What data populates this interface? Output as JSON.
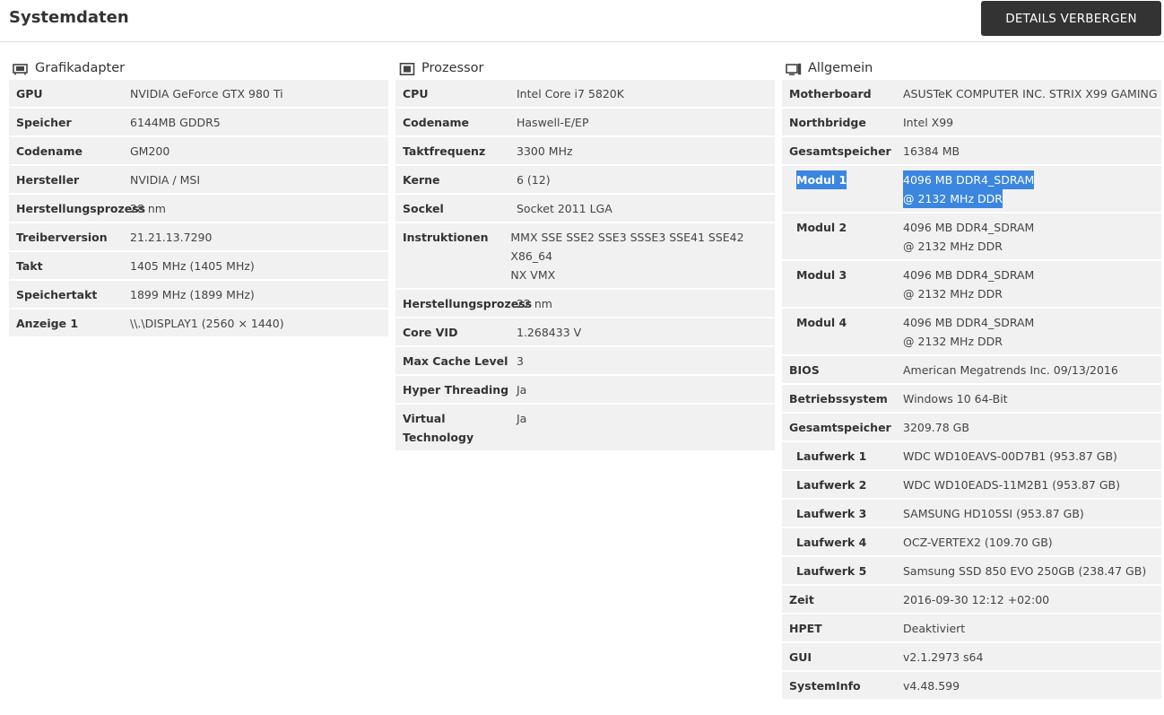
{
  "header": {
    "title": "Systemdaten",
    "toggle_label": "DETAILS VERBERGEN"
  },
  "gpu": {
    "title": "Grafikadapter",
    "rows": [
      {
        "k": "GPU",
        "v": "NVIDIA GeForce GTX 980 Ti"
      },
      {
        "k": "Speicher",
        "v": "6144MB GDDR5"
      },
      {
        "k": "Codename",
        "v": "GM200"
      },
      {
        "k": "Hersteller",
        "v": "NVIDIA / MSI"
      },
      {
        "k": "Herstellungsproze",
        "k2": "ss",
        "v": "28 nm"
      },
      {
        "k": "Treiberversion",
        "v": "21.21.13.7290"
      },
      {
        "k": "Takt",
        "v": "1405 MHz (1405 MHz)"
      },
      {
        "k": "Speichertakt",
        "v": "1899 MHz (1899 MHz)"
      },
      {
        "k": "Anzeige 1",
        "v": "\\\\.\\DISPLAY1 (2560 × 1440)"
      }
    ]
  },
  "cpu": {
    "title": "Prozessor",
    "rows": [
      {
        "k": "CPU",
        "v": "Intel Core i7 5820K"
      },
      {
        "k": "Codename",
        "v": "Haswell-E/EP"
      },
      {
        "k": "Taktfrequenz",
        "v": "3300 MHz"
      },
      {
        "k": "Kerne",
        "v": "6 (12)"
      },
      {
        "k": "Sockel",
        "v": "Socket 2011 LGA"
      },
      {
        "k": "Instruktionen",
        "v": "MMX SSE SSE2 SSE3 SSSE3 SSE41 SSE42 X86_64",
        "v2": "NX VMX"
      },
      {
        "k": "Herstellungsproze",
        "k2": "ss",
        "v": "22 nm"
      },
      {
        "k": "Core VID",
        "v": "1.268433 V"
      },
      {
        "k": "Max Cache Level",
        "v": "3"
      },
      {
        "k": "Hyper Threading",
        "v": "Ja"
      },
      {
        "k": "Virtual Technology",
        "v": "Ja"
      }
    ]
  },
  "general": {
    "title": "Allgemein",
    "rows": [
      {
        "k": "Motherboard",
        "v": "ASUSTeK COMPUTER INC. STRIX X99 GAMING"
      },
      {
        "k": "Northbridge",
        "v": "Intel X99"
      },
      {
        "k": "Gesamtspeicher",
        "v": "16384 MB"
      },
      {
        "k": "Modul 1",
        "v": "4096 MB DDR4_SDRAM",
        "v2": "@ 2132 MHz DDR",
        "sub": true,
        "selected": true
      },
      {
        "k": "Modul 2",
        "v": "4096 MB DDR4_SDRAM",
        "v2": "@ 2132 MHz DDR",
        "sub": true
      },
      {
        "k": "Modul 3",
        "v": "4096 MB DDR4_SDRAM",
        "v2": "@ 2132 MHz DDR",
        "sub": true
      },
      {
        "k": "Modul 4",
        "v": "4096 MB DDR4_SDRAM",
        "v2": "@ 2132 MHz DDR",
        "sub": true
      },
      {
        "k": "BIOS",
        "v": "American Megatrends Inc. 09/13/2016"
      },
      {
        "k": "Betriebssystem",
        "v": "Windows 10 64-Bit"
      },
      {
        "k": "Gesamtspeicher",
        "v": "3209.78 GB"
      },
      {
        "k": "Laufwerk 1",
        "v": "WDC WD10EAVS-00D7B1 (953.87 GB)",
        "sub": true
      },
      {
        "k": "Laufwerk 2",
        "v": "WDC WD10EADS-11M2B1 (953.87 GB)",
        "sub": true
      },
      {
        "k": "Laufwerk 3",
        "v": "SAMSUNG HD105SI (953.87 GB)",
        "sub": true
      },
      {
        "k": "Laufwerk 4",
        "v": "OCZ-VERTEX2 (109.70 GB)",
        "sub": true
      },
      {
        "k": "Laufwerk 5",
        "v": "Samsung SSD 850 EVO 250GB (238.47 GB)",
        "sub": true
      },
      {
        "k": "Zeit",
        "v": "2016-09-30 12:12 +02:00"
      },
      {
        "k": "HPET",
        "v": "Deaktiviert"
      },
      {
        "k": "GUI",
        "v": "v2.1.2973 s64"
      },
      {
        "k": "SystemInfo",
        "v": "v4.48.599"
      }
    ]
  },
  "colors": {
    "accent_button": "#333333",
    "row_bg": "#f1f1f1",
    "selection": "#3b86e0"
  },
  "icons": {
    "gpu": "graphics-card-icon",
    "cpu": "processor-icon",
    "general": "computer-icon"
  }
}
